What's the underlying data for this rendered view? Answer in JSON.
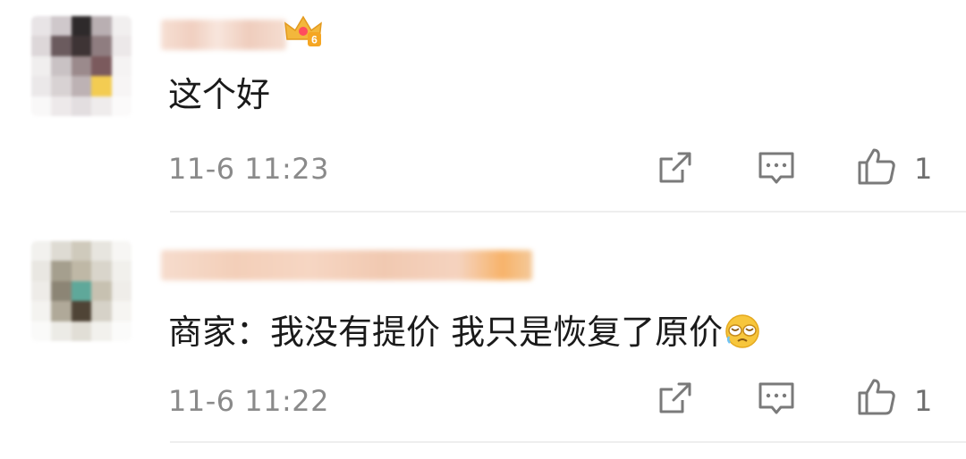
{
  "comments": [
    {
      "text": "这个好",
      "time": "11-6 11:23",
      "likes": "1",
      "badge_level": "6",
      "badge_icon": "vip-crown-badge-icon",
      "avatar_palette": [
        "#e8e4e6",
        "#cfc8cb",
        "#2e2a2b",
        "#b9afb2",
        "#f1efef",
        "#ddd7d9",
        "#6b5b5e",
        "#3e3435",
        "#8f7d80",
        "#ece8e9",
        "#f0eeee",
        "#c9c2c4",
        "#9b8a8c",
        "#7b5a5d",
        "#f5f3f3",
        "#ebe8e9",
        "#d8d2d3",
        "#bdb2b4",
        "#f3cc52",
        "#f7f5f5",
        "#f9f8f8",
        "#ede9ea",
        "#e3dee0",
        "#efecec",
        "#fbfafa"
      ]
    },
    {
      "text": "商家：我没有提价 我只是恢复了原价",
      "time": "11-6 11:22",
      "likes": "1",
      "emoji_icon": "crying-emoji-icon",
      "avatar_palette": [
        "#f2f1ee",
        "#dedbd3",
        "#cfcabc",
        "#e7e5df",
        "#f7f6f4",
        "#e9e7e2",
        "#a59f8e",
        "#bfb8a6",
        "#d9d5cb",
        "#f1f0ec",
        "#eeece8",
        "#8c8575",
        "#5fa89a",
        "#c7c1b1",
        "#efede9",
        "#f4f3f0",
        "#b0a999",
        "#4f4436",
        "#d6d2c8",
        "#f6f5f2",
        "#fafaf9",
        "#ecebe6",
        "#e1ded6",
        "#f2f1ed",
        "#fbfbfa"
      ]
    }
  ],
  "actions": {
    "share_icon": "share-icon",
    "reply_icon": "comment-reply-icon",
    "like_icon": "thumbs-up-icon"
  }
}
